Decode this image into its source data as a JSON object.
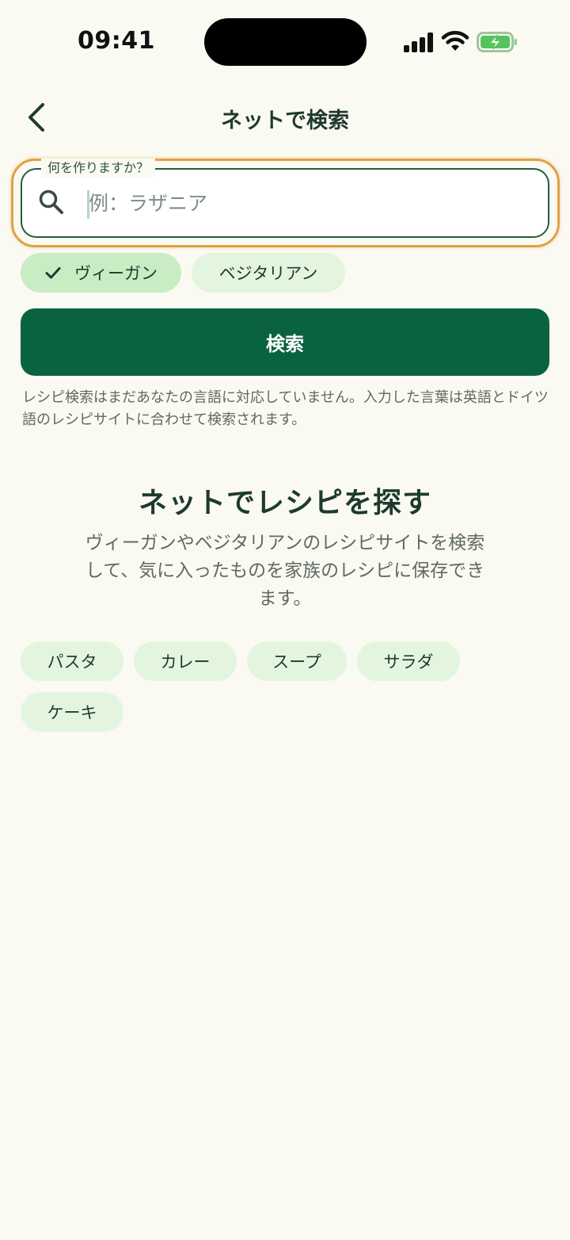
{
  "status_bar": {
    "time": "09:41"
  },
  "header": {
    "title": "ネットで検索"
  },
  "search": {
    "label": "何を作りますか？",
    "placeholder": "例：ラザニア",
    "value": ""
  },
  "filters": [
    {
      "label": "ヴィーガン",
      "selected": true
    },
    {
      "label": "ベジタリアン",
      "selected": false
    }
  ],
  "search_button": {
    "label": "検索"
  },
  "notice": "レシピ検索はまだあなたの言語に対応していません。入力した言葉は英語とドイツ語のレシピサイトに合わせて検索されます。",
  "discover": {
    "title": "ネットでレシピを探す",
    "description": "ヴィーガンやベジタリアンのレシピサイトを検索して、気に入ったものを家族のレシピに保存できます。"
  },
  "suggestions": [
    "パスタ",
    "カレー",
    "スープ",
    "サラダ",
    "ケーキ"
  ],
  "colors": {
    "background": "#fbfaf2",
    "primary": "#0a6340",
    "chip": "#e3f5de",
    "chip_selected": "#c9ecc4",
    "focus_ring": "#e0a244",
    "text": "#1d3a2d"
  },
  "icons": [
    "back-chevron-icon",
    "search-icon",
    "check-icon",
    "signal-icon",
    "wifi-icon",
    "battery-charging-icon"
  ]
}
